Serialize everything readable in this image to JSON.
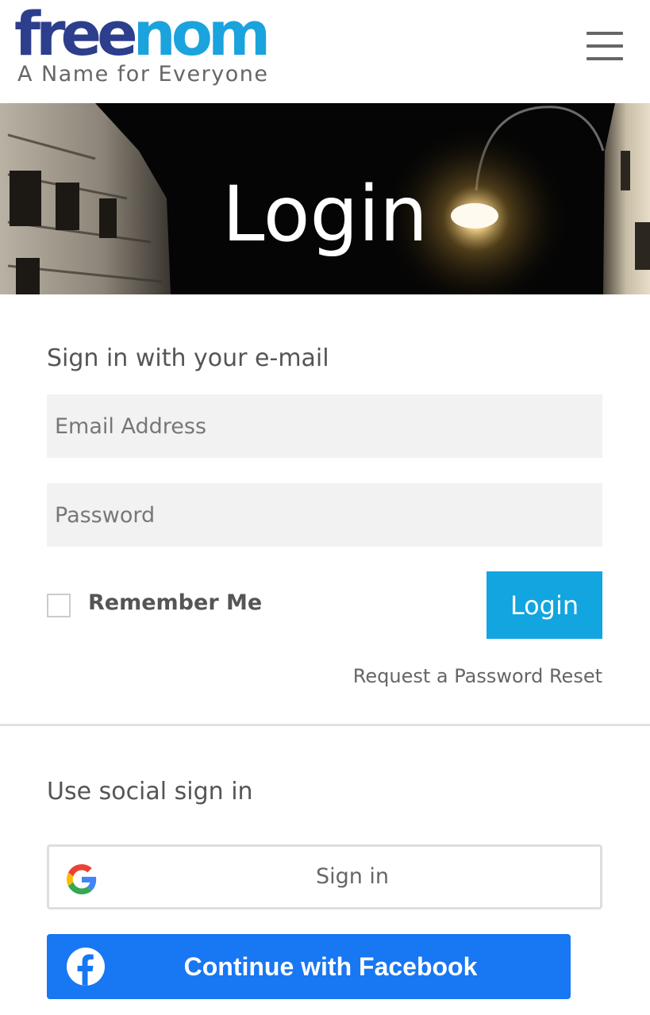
{
  "header": {
    "logo_part1": "free",
    "logo_part2": "nom",
    "tagline": "A Name for Everyone",
    "menu_icon": "hamburger-menu-icon"
  },
  "banner": {
    "title": "Login"
  },
  "email_signin": {
    "heading": "Sign in with your e-mail",
    "email_placeholder": "Email Address",
    "email_value": "",
    "password_placeholder": "Password",
    "password_value": "",
    "remember_label": "Remember Me",
    "remember_checked": false,
    "login_button": "Login",
    "reset_link": "Request a Password Reset"
  },
  "social_signin": {
    "heading": "Use social sign in",
    "google": {
      "label": "Sign in",
      "icon": "google-g-icon"
    },
    "facebook": {
      "label": "Continue with Facebook",
      "icon": "facebook-f-icon"
    }
  },
  "colors": {
    "logo_dark": "#2c3e8c",
    "logo_light": "#1aa3dd",
    "login_button": "#12a5e0",
    "facebook_blue": "#1877f2",
    "input_bg": "#f2f2f2"
  }
}
